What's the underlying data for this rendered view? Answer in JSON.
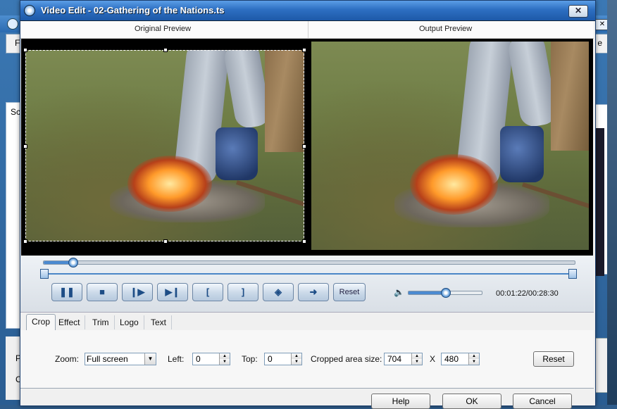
{
  "window": {
    "title": "Video Edit - 02-Gathering of the Nations.ts",
    "close_symbol": "✕"
  },
  "background_app": {
    "menu_left": "Fi",
    "menu_right": "e",
    "panel_left_text": "Sc",
    "bottom_left_1": "P",
    "bottom_left_2": "C"
  },
  "preview": {
    "original_label": "Original Preview",
    "output_label": "Output Preview"
  },
  "playback": {
    "seek_position_fraction": 0.055,
    "volume_fraction": 0.5,
    "time_current": "00:01:22",
    "time_total": "00:28:30",
    "time_display": "00:01:22/00:28:30",
    "reset_label": "Reset",
    "buttons": [
      {
        "name": "pause-icon",
        "glyph": "❚❚"
      },
      {
        "name": "stop-icon",
        "glyph": "■"
      },
      {
        "name": "play-frame-icon",
        "glyph": "❙▶"
      },
      {
        "name": "next-frame-icon",
        "glyph": "▶❙"
      },
      {
        "name": "mark-in-icon",
        "glyph": "["
      },
      {
        "name": "mark-out-icon",
        "glyph": "]"
      },
      {
        "name": "snapshot-icon",
        "glyph": "◈"
      },
      {
        "name": "return-icon",
        "glyph": "➜"
      }
    ]
  },
  "tabs": [
    {
      "label": "Crop",
      "active": true
    },
    {
      "label": "Effect",
      "active": false
    },
    {
      "label": "Trim",
      "active": false
    },
    {
      "label": "Logo",
      "active": false
    },
    {
      "label": "Text",
      "active": false
    }
  ],
  "crop": {
    "zoom_label": "Zoom:",
    "zoom_value": "Full screen",
    "left_label": "Left:",
    "left_value": "0",
    "top_label": "Top:",
    "top_value": "0",
    "area_label": "Cropped area size:",
    "width_value": "704",
    "x_label": "X",
    "height_value": "480",
    "reset_label": "Reset"
  },
  "footer": {
    "help_label": "Help",
    "ok_label": "OK",
    "cancel_label": "Cancel"
  },
  "colors": {
    "title_bar": "#2d6fc2",
    "accent": "#4b8ad1"
  }
}
